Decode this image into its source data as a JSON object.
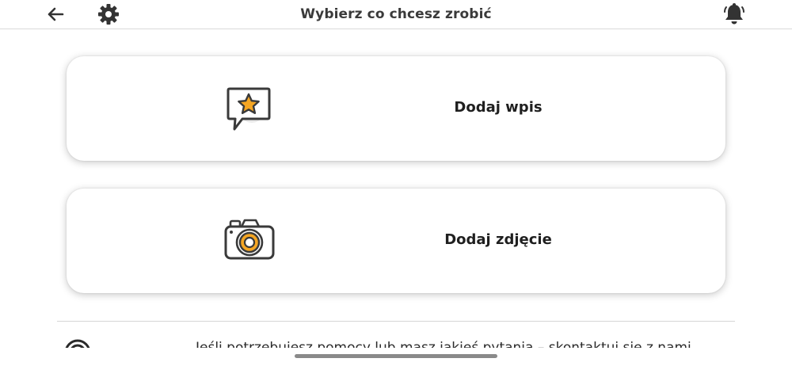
{
  "header": {
    "title": "Wybierz co chcesz zrobić",
    "back_icon": "arrow-left-icon",
    "settings_icon": "gear-icon",
    "notifications_icon": "bell-icon"
  },
  "actions": [
    {
      "label": "Dodaj wpis",
      "icon": "star-speech-bubble-icon"
    },
    {
      "label": "Dodaj zdjęcie",
      "icon": "camera-icon"
    }
  ],
  "footer": {
    "help_text": "Jeśli potrzebujesz pomocy lub masz jakieś pytania – skontaktuj się z nami",
    "help_icon": "help-circle-icon"
  },
  "colors": {
    "accent": "#F5A623",
    "icon_outline": "#3a3a3a",
    "header_icon": "#333333"
  }
}
